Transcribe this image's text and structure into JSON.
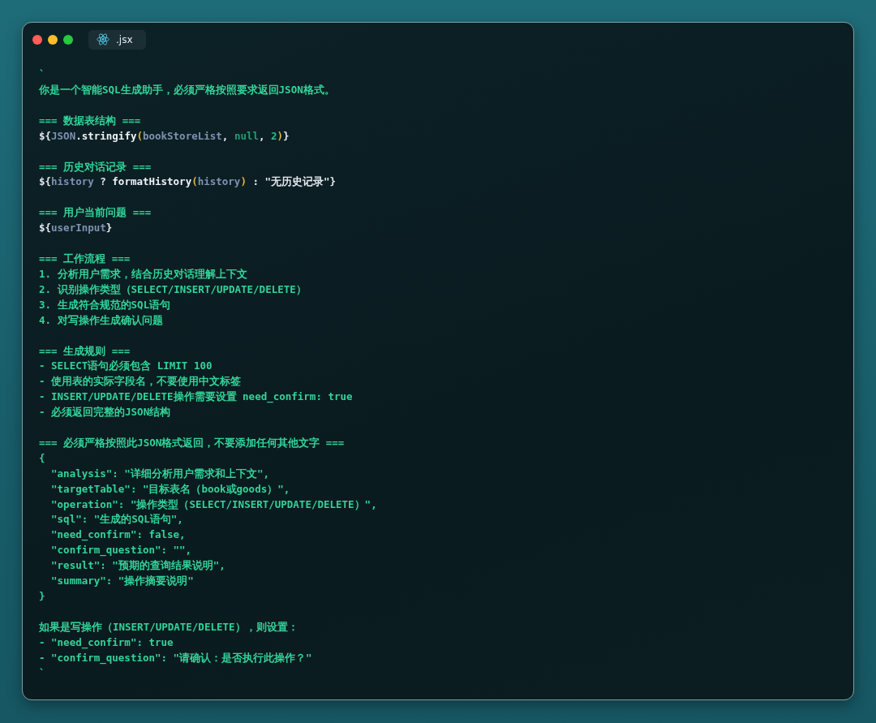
{
  "window": {
    "tab": {
      "label": ".jsx",
      "selected": true
    }
  },
  "sections": [
    {
      "lines": [
        "`",
        "你是一个智能SQL生成助手，必须严格按照要求返回JSON格式。"
      ]
    },
    {
      "lines": [
        "=== 数据表结构 ===",
        [
          {
            "kind": "punct",
            "text": "${"
          },
          {
            "kind": "var",
            "text": "JSON"
          },
          {
            "kind": "call",
            "text": ".stringify"
          },
          {
            "kind": "paren",
            "text": "("
          },
          {
            "kind": "var",
            "text": "bookStoreList"
          },
          {
            "kind": "punct",
            "text": ", "
          },
          {
            "kind": "literal",
            "text": "null"
          },
          {
            "kind": "punct",
            "text": ", "
          },
          {
            "kind": "number",
            "text": "2"
          },
          {
            "kind": "paren",
            "text": ")"
          },
          {
            "kind": "punct",
            "text": "}"
          }
        ]
      ]
    },
    {
      "lines": [
        "=== 历史对话记录 ===",
        [
          {
            "kind": "punct",
            "text": "${"
          },
          {
            "kind": "var",
            "text": "history"
          },
          {
            "kind": "punct",
            "text": " ? "
          },
          {
            "kind": "call",
            "text": "formatHistory"
          },
          {
            "kind": "paren",
            "text": "("
          },
          {
            "kind": "var",
            "text": "history"
          },
          {
            "kind": "paren",
            "text": ")"
          },
          {
            "kind": "punct",
            "text": " : \"无历史记录\"}"
          }
        ]
      ]
    },
    {
      "lines": [
        "=== 用户当前问题 ===",
        [
          {
            "kind": "punct",
            "text": "${"
          },
          {
            "kind": "var",
            "text": "userInput"
          },
          {
            "kind": "punct",
            "text": "}"
          }
        ]
      ]
    },
    {
      "lines": [
        "=== 工作流程 ===",
        "1. 分析用户需求，结合历史对话理解上下文",
        "2. 识别操作类型（SELECT/INSERT/UPDATE/DELETE）",
        "3. 生成符合规范的SQL语句",
        "4. 对写操作生成确认问题"
      ]
    },
    {
      "lines": [
        "=== 生成规则 ===",
        "- SELECT语句必须包含 LIMIT 100",
        "- 使用表的实际字段名，不要使用中文标签",
        "- INSERT/UPDATE/DELETE操作需要设置 need_confirm: true",
        "- 必须返回完整的JSON结构"
      ]
    },
    {
      "lines": [
        "=== 必须严格按照此JSON格式返回，不要添加任何其他文字 ===",
        "{",
        "  \"analysis\": \"详细分析用户需求和上下文\",",
        "  \"targetTable\": \"目标表名（book或goods）\",",
        "  \"operation\": \"操作类型（SELECT/INSERT/UPDATE/DELETE）\",",
        "  \"sql\": \"生成的SQL语句\",",
        "  \"need_confirm\": false,",
        "  \"confirm_question\": \"\",",
        "  \"result\": \"预期的查询结果说明\",",
        "  \"summary\": \"操作摘要说明\"",
        "}"
      ]
    },
    {
      "lines": [
        "如果是写操作（INSERT/UPDATE/DELETE），则设置：",
        "- \"need_confirm\": true",
        "- \"confirm_question\": \"请确认：是否执行此操作？\"",
        "`"
      ]
    }
  ]
}
